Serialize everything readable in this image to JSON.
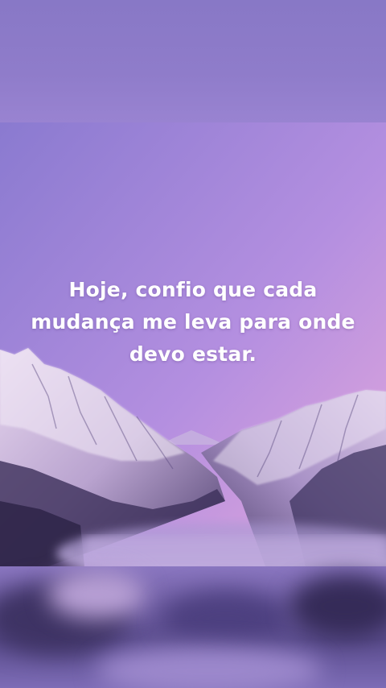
{
  "quote": {
    "lines": [
      "Hoje, confio que cada",
      "mudança me leva para onde",
      "devo estar."
    ]
  },
  "colors": {
    "sky_top": "#8a7ad0",
    "sky_bottom": "#e2a6dc",
    "mountain_light": "#d9c5e6",
    "mountain_dark": "#5a4a7a",
    "fog": "#b9a6da"
  }
}
